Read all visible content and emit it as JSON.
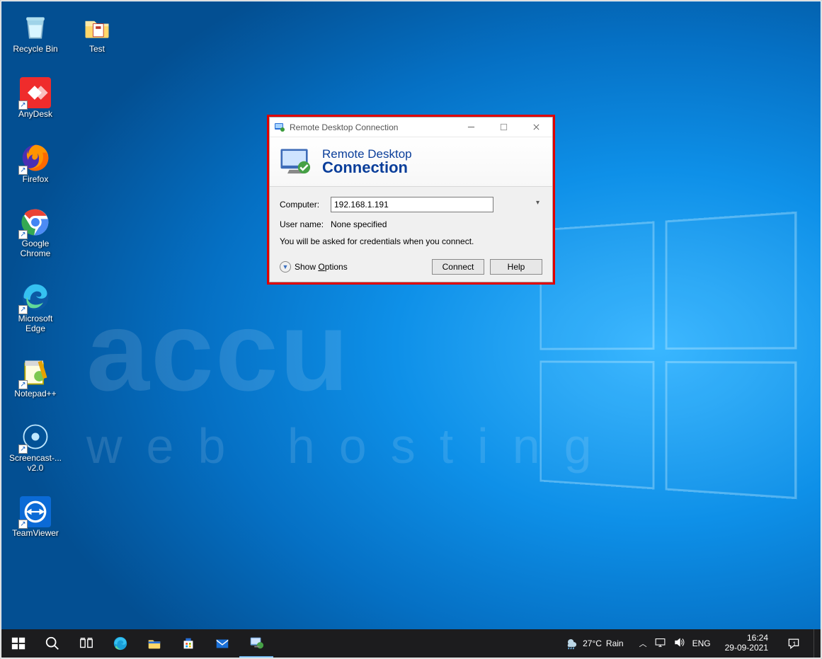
{
  "desktop_icons": [
    {
      "label": "Recycle Bin"
    },
    {
      "label": "AnyDesk"
    },
    {
      "label": "Firefox"
    },
    {
      "label": "Google Chrome"
    },
    {
      "label": "Microsoft Edge"
    },
    {
      "label": "Notepad++"
    },
    {
      "label": "Screencast-... v2.0"
    },
    {
      "label": "TeamViewer"
    }
  ],
  "test_icon": {
    "label": "Test"
  },
  "watermark": {
    "top": "accu",
    "bottom": "web hosting"
  },
  "rdc": {
    "title": "Remote Desktop Connection",
    "head1": "Remote Desktop",
    "head2": "Connection",
    "computer_label": "Computer:",
    "computer_value": "192.168.1.191",
    "user_label": "User name:",
    "user_value": "None specified",
    "hint": "You will be asked for credentials when you connect.",
    "show_options": "Show Options",
    "connect": "Connect",
    "help": "Help"
  },
  "taskbar": {
    "weather_temp": "27°C",
    "weather_desc": "Rain",
    "lang": "ENG",
    "time": "16:24",
    "date": "29-09-2021",
    "notif_count": "1"
  }
}
